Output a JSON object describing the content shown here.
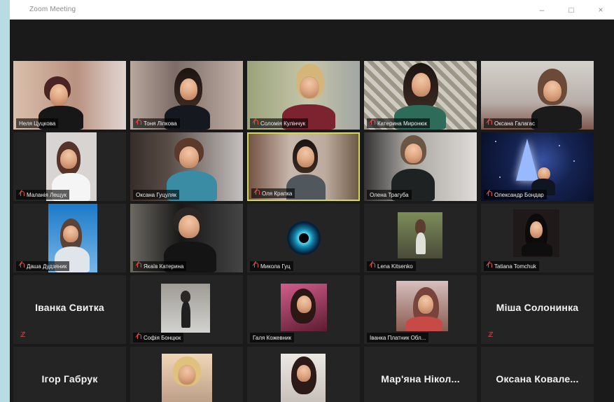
{
  "window": {
    "title": "Zoom Meeting",
    "controls": [
      "–",
      "□",
      "×"
    ]
  },
  "participants": [
    {
      "name": "Неля Цуцкова",
      "muted": false
    },
    {
      "name": "Тоня Ліпкова",
      "muted": true
    },
    {
      "name": "Соломія Кулінчук",
      "muted": true
    },
    {
      "name": "Катерина Миронюк",
      "muted": true
    },
    {
      "name": "Оксана Галагас",
      "muted": true
    },
    {
      "name": "Маланія Лещук",
      "muted": true
    },
    {
      "name": "Оксана Гуцуляк",
      "muted": false
    },
    {
      "name": "Оля Крапка",
      "muted": true
    },
    {
      "name": "Олена Трагуба",
      "muted": false
    },
    {
      "name": "Олександр Бондар",
      "muted": true
    },
    {
      "name": "Даша Дудзяник",
      "muted": true
    },
    {
      "name": "Якаїв Катерина",
      "muted": true
    },
    {
      "name": "Микола Гуц",
      "muted": true
    },
    {
      "name": "Lena Kitsenko",
      "muted": true
    },
    {
      "name": "Tatiana Tomchuk",
      "muted": true
    },
    {
      "name": "Іванка Свитка",
      "muted": true
    },
    {
      "name": "Софія Бонцюк",
      "muted": true
    },
    {
      "name": "Галя Кожевник",
      "muted": false
    },
    {
      "name": "Іванка Платник Обл...",
      "muted": false
    },
    {
      "name": "Міша Солонинка",
      "muted": true
    },
    {
      "name": "Ігор Габрук",
      "muted": false
    },
    {
      "name": "",
      "muted": false
    },
    {
      "name": "",
      "muted": false
    },
    {
      "name": "Мар'яна Нікол...",
      "muted": false
    },
    {
      "name": "Оксана Ковале...",
      "muted": false
    }
  ],
  "colors": {
    "background": "#1a1a1a",
    "active_border": "#d7da4f",
    "mute_icon": "#f14a4a"
  }
}
